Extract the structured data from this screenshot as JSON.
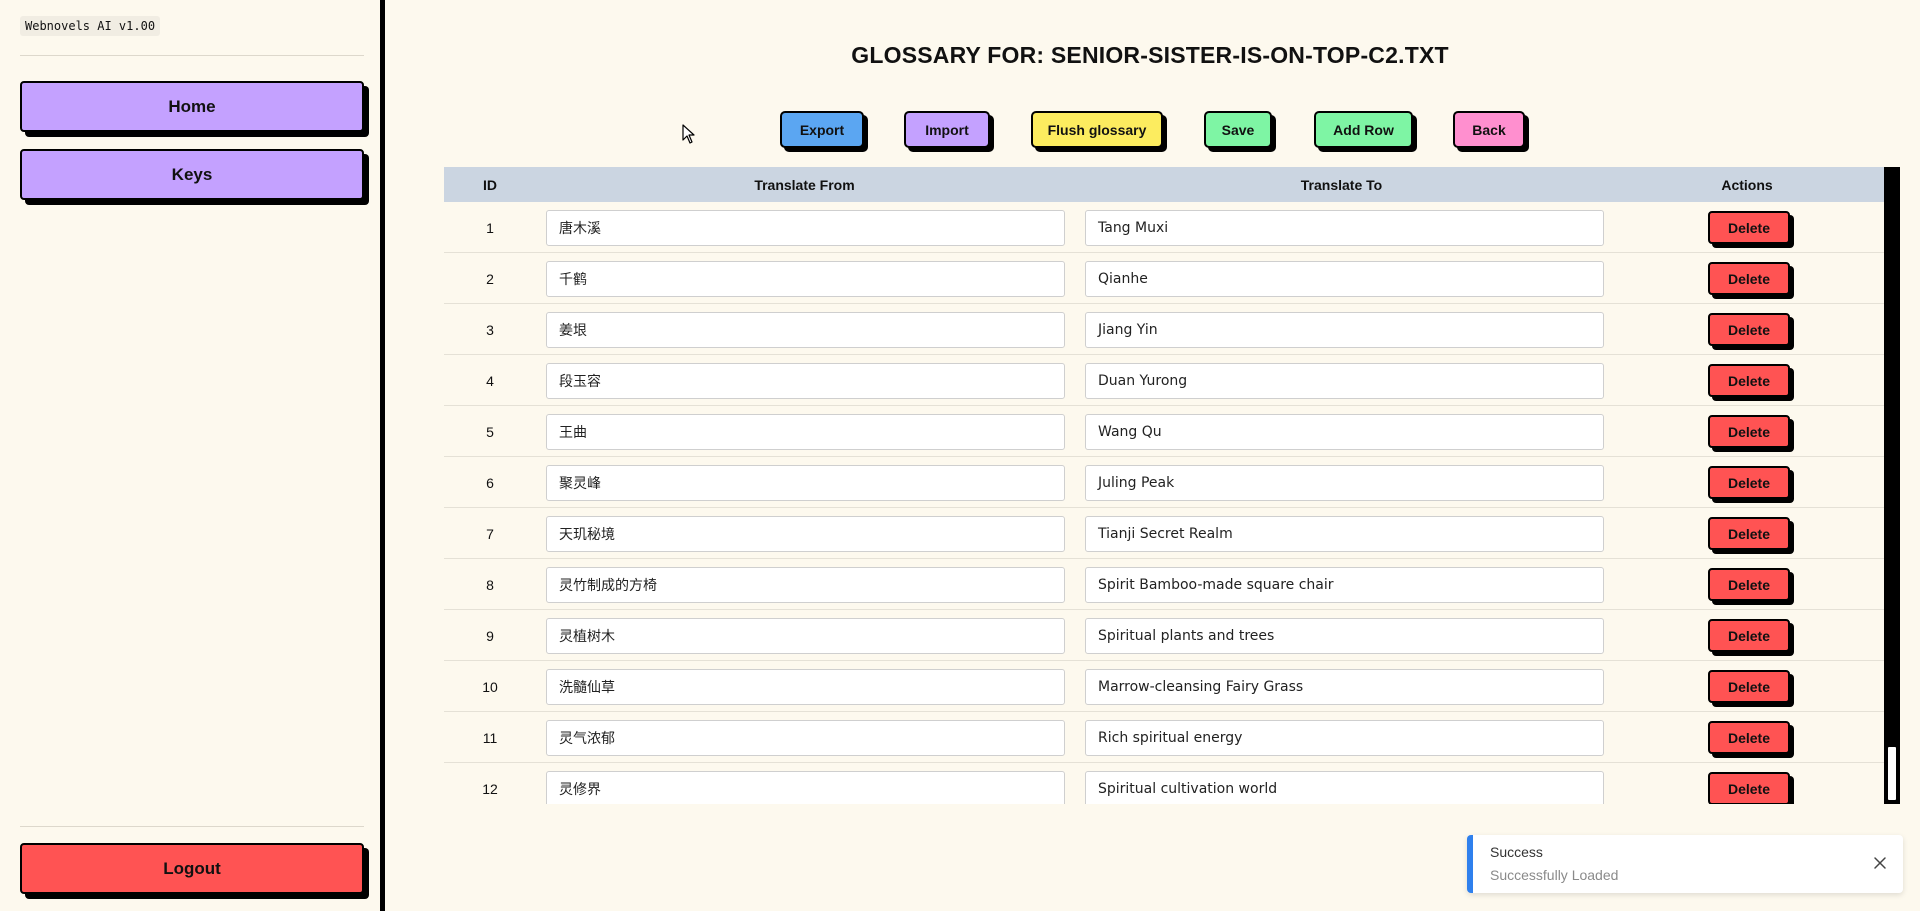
{
  "sidebar": {
    "version": "Webnovels AI v1.00",
    "nav": {
      "home": "Home",
      "keys": "Keys",
      "logout": "Logout"
    }
  },
  "main": {
    "title": "GLOSSARY FOR: SENIOR-SISTER-IS-ON-TOP-C2.TXT",
    "toolbar": {
      "export": "Export",
      "import": "Import",
      "flush": "Flush glossary",
      "save": "Save",
      "add_row": "Add Row",
      "back": "Back"
    },
    "table": {
      "headers": {
        "id": "ID",
        "from": "Translate From",
        "to": "Translate To",
        "actions": "Actions"
      },
      "delete_label": "Delete",
      "rows": [
        {
          "id": "1",
          "from": "唐木溪",
          "to": "Tang Muxi"
        },
        {
          "id": "2",
          "from": "千鹤",
          "to": "Qianhe"
        },
        {
          "id": "3",
          "from": "姜垠",
          "to": "Jiang Yin"
        },
        {
          "id": "4",
          "from": "段玉容",
          "to": "Duan Yurong"
        },
        {
          "id": "5",
          "from": "王曲",
          "to": "Wang Qu"
        },
        {
          "id": "6",
          "from": "聚灵峰",
          "to": "Juling Peak"
        },
        {
          "id": "7",
          "from": "天玑秘境",
          "to": "Tianji Secret Realm"
        },
        {
          "id": "8",
          "from": "灵竹制成的方椅",
          "to": "Spirit Bamboo-made square chair"
        },
        {
          "id": "9",
          "from": "灵植树木",
          "to": "Spiritual plants and trees"
        },
        {
          "id": "10",
          "from": "洗髓仙草",
          "to": "Marrow-cleansing Fairy Grass"
        },
        {
          "id": "11",
          "from": "灵气浓郁",
          "to": "Rich spiritual energy"
        },
        {
          "id": "12",
          "from": "灵修界",
          "to": "Spiritual cultivation world"
        }
      ]
    }
  },
  "toast": {
    "title": "Success",
    "message": "Successfully Loaded",
    "accent": "#2f80ed"
  },
  "icons": {
    "cursor": "mouse-pointer-icon",
    "close": "close-icon"
  },
  "colors": {
    "background": "#fdf9ee",
    "purple": "#c4a1ff",
    "red": "#ff5353",
    "blue": "#5ba6f2",
    "yellow": "#fcec5f",
    "green": "#7ef5a4",
    "pink": "#ff8fcf",
    "header": "#cbd5e1"
  }
}
